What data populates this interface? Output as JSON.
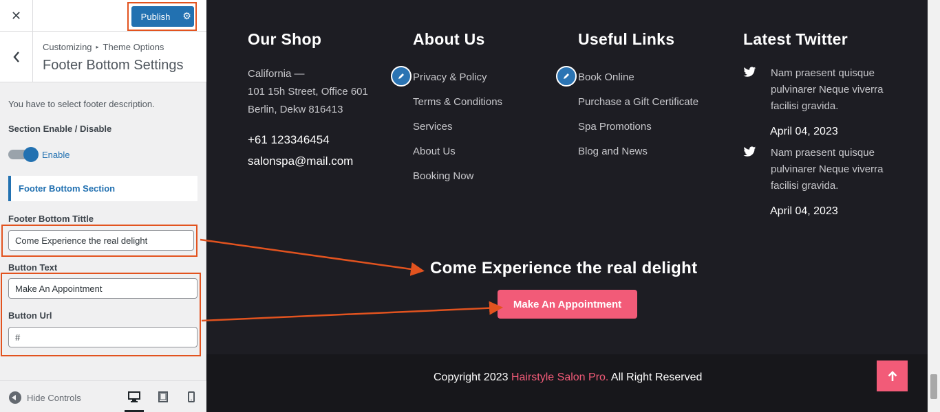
{
  "customizer": {
    "close_icon": "close-icon",
    "publish_label": "Publish",
    "breadcrumb_root": "Customizing",
    "breadcrumb_parent": "Theme Options",
    "section_title": "Footer Bottom Settings",
    "description": "You have to select footer description.",
    "enable_label": "Section Enable / Disable",
    "toggle_state_label": "Enable",
    "toggle_on": true,
    "subsection_label": "Footer Bottom Section",
    "title_label": "Footer Bottom Tittle",
    "title_value": "Come Experience the real delight",
    "button_text_label": "Button Text",
    "button_text_value": "Make An Appointment",
    "button_url_label": "Button Url",
    "button_url_value": "#",
    "hide_controls_label": "Hide Controls",
    "devices": [
      "desktop",
      "tablet",
      "mobile"
    ],
    "accent_color": "#2271b1",
    "highlight_color": "#e2531f"
  },
  "preview": {
    "shop": {
      "title": "Our Shop",
      "address_line1": "California —",
      "address_line2": "101 15h Street, Office 601",
      "address_line3": "Berlin, Dekw 816413",
      "phone": "+61 123346454",
      "email": "salonspa@mail.com"
    },
    "about": {
      "title": "About Us",
      "links": [
        "Privacy & Policy",
        "Terms & Conditions",
        "Services",
        "About Us",
        "Booking Now"
      ]
    },
    "useful": {
      "title": "Useful Links",
      "links": [
        "Book Online",
        "Purchase a Gift Certificate",
        "Spa Promotions",
        "Blog and News"
      ]
    },
    "twitter": {
      "title": "Latest Twitter",
      "tweets": [
        {
          "text": "Nam praesent quisque pulvinarer Neque viverra facilisi gravida.",
          "date": "April 04, 2023"
        },
        {
          "text": "Nam praesent quisque pulvinarer Neque viverra facilisi gravida.",
          "date": "April 04, 2023"
        }
      ]
    },
    "cta": {
      "title": "Come Experience the real delight",
      "button": "Make An Appointment"
    },
    "copyright": {
      "prefix": "Copyright 2023 ",
      "brand": "Hairstyle Salon Pro.",
      "suffix": " All Right Reserved"
    },
    "brand_color": "#f25b78",
    "background_color": "#1d1d23"
  }
}
